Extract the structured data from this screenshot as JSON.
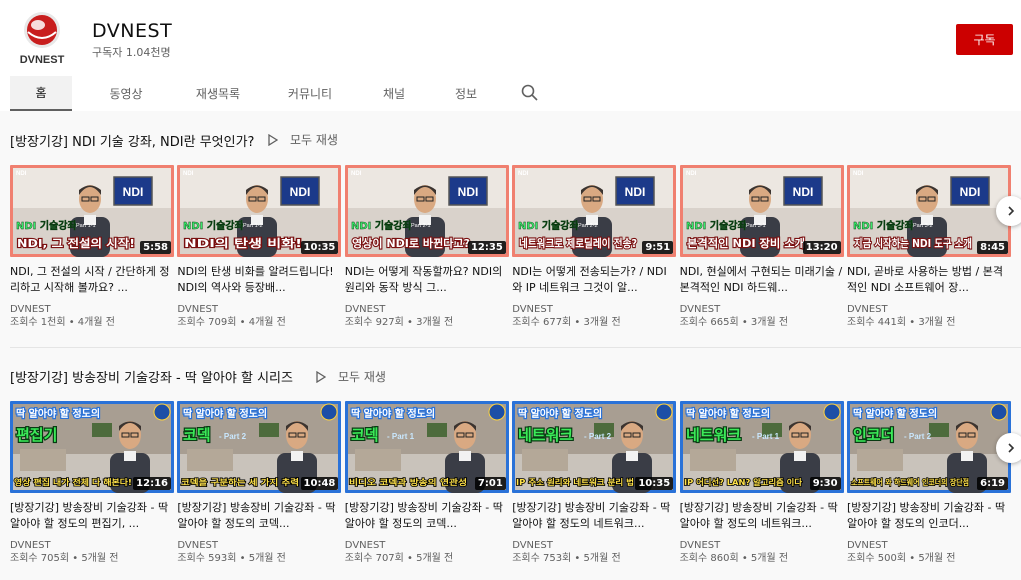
{
  "channel": {
    "name": "DVNEST",
    "logo_text": "DVNEST",
    "subscribers": "구독자 1.04천명",
    "subscribe_label": "구독"
  },
  "tabs": [
    {
      "label": "홈",
      "active": true
    },
    {
      "label": "동영상",
      "active": false
    },
    {
      "label": "재생목록",
      "active": false
    },
    {
      "label": "커뮤니티",
      "active": false
    },
    {
      "label": "채널",
      "active": false
    },
    {
      "label": "정보",
      "active": false
    }
  ],
  "sections": [
    {
      "title": "[방장기강] NDI 기술 강좌, NDI란 무엇인가?",
      "play_all": "모두 재생",
      "videos": [
        {
          "caption": "NDI, 그 전설의 시작!",
          "badge": "NDI",
          "part": "Part 1-1",
          "series": "NDI 기술강좌",
          "duration": "5:58",
          "title": "NDI, 그 전설의 시작 / 간단하게 정리하고 시작해 볼까요? ...",
          "channel": "DVNEST",
          "meta": "조회수 1천회 • 4개월 전"
        },
        {
          "caption": "NDI의 탄생 비화!",
          "badge": "NDI",
          "part": "Part 1-2",
          "series": "NDI 기술강좌",
          "duration": "10:35",
          "title": "NDI의 탄생 비화를 알려드립니다! NDI의 역사와 등장배...",
          "channel": "DVNEST",
          "meta": "조회수 709회 • 4개월 전"
        },
        {
          "caption": "영상이 NDI로 바뀐다고?",
          "badge": "NDI",
          "part": "Part 2-1",
          "series": "NDI 기술강좌",
          "duration": "12:35",
          "title": "NDI는 어떻게 작동할까요? NDI의 원리와 동작 방식 그...",
          "channel": "DVNEST",
          "meta": "조회수 927회 • 3개월 전"
        },
        {
          "caption": "네트워크로 제로딜레이 전송?",
          "badge": "NDI",
          "part": "Part 2-2",
          "series": "NDI 기술강좌",
          "duration": "9:51",
          "title": "NDI는 어떻게 전송되는가? / NDI와 IP 네트워크 그것이 알...",
          "channel": "DVNEST",
          "meta": "조회수 677회 • 3개월 전"
        },
        {
          "caption": "본격적인 NDI 장비 소개",
          "badge": "NDI",
          "part": "Part 3-1",
          "series": "NDI 기술강좌",
          "duration": "13:20",
          "title": "NDI, 현실에서 구현되는 미래기술 / 본격적인 NDI 하드웨...",
          "channel": "DVNEST",
          "meta": "조회수 665회 • 3개월 전"
        },
        {
          "caption": "지금 시작하는 NDI 도구 소개",
          "badge": "NDI",
          "part": "Part 3-2",
          "series": "NDI 기술강좌",
          "duration": "8:45",
          "title": "NDI, 곧바로 사용하는 방법 / 본격적인 NDI 소프트웨어 장...",
          "channel": "DVNEST",
          "meta": "조회수 441회 • 3개월 전"
        }
      ]
    },
    {
      "title": "[방장기강] 방송장비 기술강좌 - 딱 알아야 할 시리즈",
      "play_all": "모두 재생",
      "videos": [
        {
          "header": "딱 알아야 할 정도의",
          "topic": "편집기",
          "part": "",
          "caption": "영상 편집 내가 전체 다 해본다!",
          "duration": "12:16",
          "title": "[방장기강] 방송장비 기술강좌 - 딱 알아야 할 정도의 편집기, ...",
          "channel": "DVNEST",
          "meta": "조회수 705회 • 5개월 전"
        },
        {
          "header": "딱 알아야 할 정도의",
          "topic": "코덱",
          "part": "Part 2",
          "caption": "코덱을 구분하는 세 가지 추력",
          "duration": "10:48",
          "title": "[방장기강] 방송장비 기술강좌 - 딱 알아야 할 정도의 코덱...",
          "channel": "DVNEST",
          "meta": "조회수 593회 • 5개월 전"
        },
        {
          "header": "딱 알아야 할 정도의",
          "topic": "코덱",
          "part": "Part 1",
          "caption": "비디오 코덱과 방송의 연관성",
          "duration": "7:01",
          "title": "[방장기강] 방송장비 기술강좌 - 딱 알아야 할 정도의 코덱...",
          "channel": "DVNEST",
          "meta": "조회수 707회 • 5개월 전"
        },
        {
          "header": "딱 알아야 할 정도의",
          "topic": "네트워크",
          "part": "Part 2",
          "caption": "IP 주소 원리와 네트워크 분리 법",
          "duration": "10:35",
          "title": "[방장기강] 방송장비 기술강좌 - 딱 알아야 할 정도의 네트워크...",
          "channel": "DVNEST",
          "meta": "조회수 753회 • 5개월 전"
        },
        {
          "header": "딱 알아야 할 정도의",
          "topic": "네트워크",
          "part": "Part 1",
          "caption": "IP 어디선? LAN? 알고리즘 이다",
          "duration": "9:30",
          "title": "[방장기강] 방송장비 기술강좌 - 딱 알아야 할 정도의 네트워크...",
          "channel": "DVNEST",
          "meta": "조회수 860회 • 5개월 전"
        },
        {
          "header": "딱 알아야 할 정도의",
          "topic": "인코더",
          "part": "Part 2",
          "caption": "소프트웨어 와 하드웨어 인코더의 장단점",
          "duration": "6:19",
          "title": "[방장기강] 방송장비 기술강좌 - 딱 알아야 할 정도의 인코더...",
          "channel": "DVNEST",
          "meta": "조회수 500회 • 5개월 전"
        }
      ]
    }
  ],
  "colors": {
    "subscribe": "#cc0000",
    "ndi_border": "#f08070",
    "ndi_caption": "#ffffff",
    "series_label": "#39e86a",
    "gear_header": "#2a72d8",
    "gear_topic": "#3bea58"
  },
  "icons": [
    "search-icon",
    "play-icon",
    "chevron-right-icon"
  ]
}
